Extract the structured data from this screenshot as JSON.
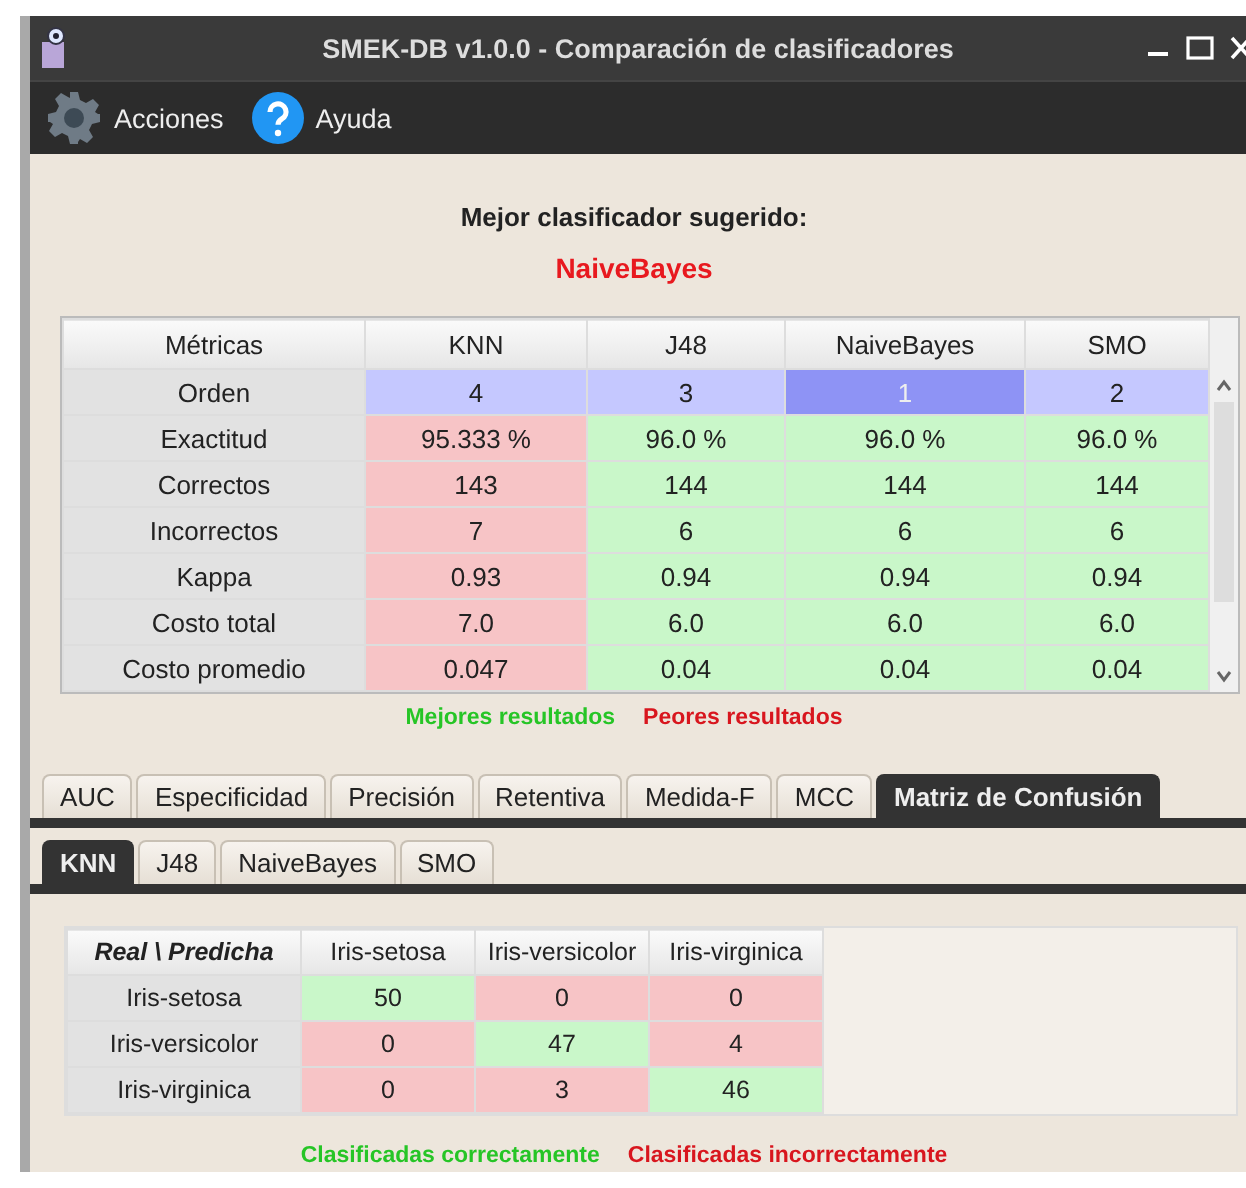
{
  "window": {
    "title": "SMEK-DB v1.0.0 - Comparación de clasificadores"
  },
  "menu": [
    {
      "label": "Acciones"
    },
    {
      "label": "Ayuda"
    }
  ],
  "suggestion": {
    "heading": "Mejor clasificador sugerido:",
    "winner": "NaiveBayes"
  },
  "metrics_table": {
    "corner": "Métricas",
    "columns": [
      "KNN",
      "J48",
      "NaiveBayes",
      "SMO"
    ],
    "rows": [
      {
        "label": "Orden",
        "cells": [
          {
            "text": "4",
            "kind": "rank",
            "selected": false
          },
          {
            "text": "3",
            "kind": "rank",
            "selected": false
          },
          {
            "text": "1",
            "kind": "rank",
            "selected": true
          },
          {
            "text": "2",
            "kind": "rank",
            "selected": false
          }
        ]
      },
      {
        "label": "Exactitud",
        "cells": [
          {
            "text": "95.333 %",
            "kind": "bad"
          },
          {
            "text": "96.0 %",
            "kind": "good"
          },
          {
            "text": "96.0 %",
            "kind": "good"
          },
          {
            "text": "96.0 %",
            "kind": "good"
          }
        ]
      },
      {
        "label": "Correctos",
        "cells": [
          {
            "text": "143",
            "kind": "bad"
          },
          {
            "text": "144",
            "kind": "good"
          },
          {
            "text": "144",
            "kind": "good"
          },
          {
            "text": "144",
            "kind": "good"
          }
        ]
      },
      {
        "label": "Incorrectos",
        "cells": [
          {
            "text": "7",
            "kind": "bad"
          },
          {
            "text": "6",
            "kind": "good"
          },
          {
            "text": "6",
            "kind": "good"
          },
          {
            "text": "6",
            "kind": "good"
          }
        ]
      },
      {
        "label": "Kappa",
        "cells": [
          {
            "text": "0.93",
            "kind": "bad"
          },
          {
            "text": "0.94",
            "kind": "good"
          },
          {
            "text": "0.94",
            "kind": "good"
          },
          {
            "text": "0.94",
            "kind": "good"
          }
        ]
      },
      {
        "label": "Costo total",
        "cells": [
          {
            "text": "7.0",
            "kind": "bad"
          },
          {
            "text": "6.0",
            "kind": "good"
          },
          {
            "text": "6.0",
            "kind": "good"
          },
          {
            "text": "6.0",
            "kind": "good"
          }
        ]
      },
      {
        "label": "Costo promedio",
        "cells": [
          {
            "text": "0.047",
            "kind": "bad"
          },
          {
            "text": "0.04",
            "kind": "good"
          },
          {
            "text": "0.04",
            "kind": "good"
          },
          {
            "text": "0.04",
            "kind": "good"
          }
        ]
      }
    ]
  },
  "metrics_legend": [
    {
      "label": "Mejores resultados",
      "kind": "good"
    },
    {
      "label": "Peores resultados",
      "kind": "bad"
    }
  ],
  "tabs": [
    {
      "label": "AUC",
      "selected": false
    },
    {
      "label": "Especificidad",
      "selected": false
    },
    {
      "label": "Precisión",
      "selected": false
    },
    {
      "label": "Retentiva",
      "selected": false
    },
    {
      "label": "Medida-F",
      "selected": false
    },
    {
      "label": "MCC",
      "selected": false
    },
    {
      "label": "Matriz de Confusión",
      "selected": true
    }
  ],
  "classifier_tabs": [
    {
      "label": "KNN",
      "selected": true
    },
    {
      "label": "J48",
      "selected": false
    },
    {
      "label": "NaiveBayes",
      "selected": false
    },
    {
      "label": "SMO",
      "selected": false
    }
  ],
  "confusion_matrix": {
    "corner": "Real \\ Predicha",
    "columns": [
      "Iris-setosa",
      "Iris-versicolor",
      "Iris-virginica"
    ],
    "rows": [
      {
        "label": "Iris-setosa",
        "cells": [
          {
            "text": "50",
            "kind": "good"
          },
          {
            "text": "0",
            "kind": "bad"
          },
          {
            "text": "0",
            "kind": "bad"
          }
        ]
      },
      {
        "label": "Iris-versicolor",
        "cells": [
          {
            "text": "0",
            "kind": "bad"
          },
          {
            "text": "47",
            "kind": "good"
          },
          {
            "text": "4",
            "kind": "bad"
          }
        ]
      },
      {
        "label": "Iris-virginica",
        "cells": [
          {
            "text": "0",
            "kind": "bad"
          },
          {
            "text": "3",
            "kind": "bad"
          },
          {
            "text": "46",
            "kind": "good"
          }
        ]
      }
    ]
  },
  "confusion_legend": [
    {
      "label": "Clasificadas correctamente",
      "kind": "good"
    },
    {
      "label": "Clasificadas incorrectamente",
      "kind": "bad"
    }
  ]
}
